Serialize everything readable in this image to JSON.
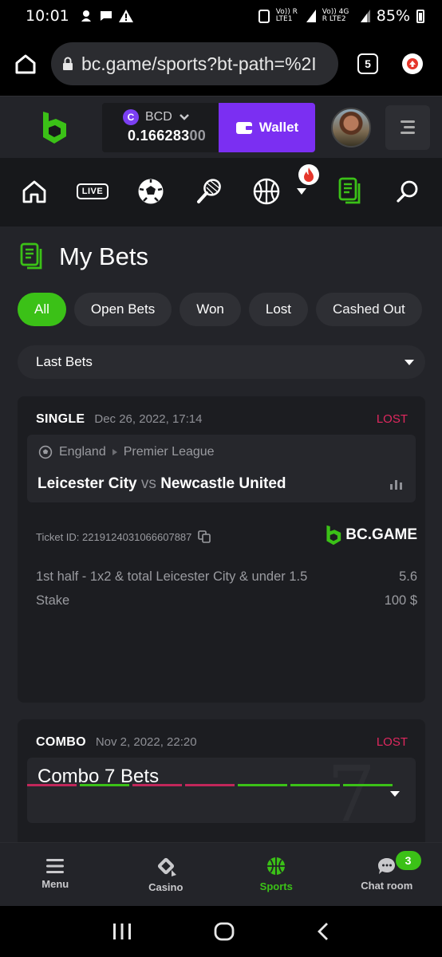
{
  "status_bar": {
    "time": "10:01",
    "net1": "Vo)) R LTE1",
    "net2": "Vo)) 4G R LTE2",
    "battery": "85%"
  },
  "browser": {
    "url": "bc.game/sports?bt-path=%2I",
    "tab_count": "5"
  },
  "header": {
    "currency": "BCD",
    "currency_symbol": "C",
    "balance_main": "0.166283",
    "balance_dim": "00",
    "wallet_label": "Wallet"
  },
  "sport_nav": {
    "live_label": "LIVE",
    "icons": [
      "home-icon",
      "live-icon",
      "soccer-icon",
      "tennis-icon",
      "basketball-icon",
      "more-dropdown-icon",
      "my-bets-icon",
      "search-icon"
    ]
  },
  "page": {
    "title": "My Bets",
    "filters": [
      "All",
      "Open Bets",
      "Won",
      "Lost",
      "Cashed Out"
    ],
    "active_filter": "All",
    "dropdown_value": "Last Bets"
  },
  "bets": [
    {
      "type": "SINGLE",
      "date": "Dec 26, 2022, 17:14",
      "status": "LOST",
      "country": "England",
      "league": "Premier League",
      "home": "Leicester City",
      "vs": "vs",
      "away": "Newcastle United",
      "ticket": "Ticket ID: 2219124031066607887",
      "brand": "BC.GAME",
      "selection": "1st half - 1x2 & total Leicester City & under 1.5",
      "odds": "5.6",
      "stake_label": "Stake",
      "stake": "100 $"
    },
    {
      "type": "COMBO",
      "date": "Nov 2, 2022, 22:20",
      "status": "LOST",
      "title": "Combo 7 Bets",
      "big_number": "7",
      "legs": [
        "lost",
        "won",
        "lost",
        "lost",
        "won",
        "won",
        "won"
      ]
    }
  ],
  "bottom_nav": [
    {
      "label": "Menu",
      "icon": "menu-icon"
    },
    {
      "label": "Casino",
      "icon": "casino-icon"
    },
    {
      "label": "Sports",
      "icon": "sports-icon"
    },
    {
      "label": "Chat room",
      "icon": "chat-icon",
      "badge": "3"
    }
  ],
  "colors": {
    "accent": "#3bc117",
    "wallet": "#7b2ff2",
    "lost": "#e0285f",
    "won": "#3bc117"
  }
}
